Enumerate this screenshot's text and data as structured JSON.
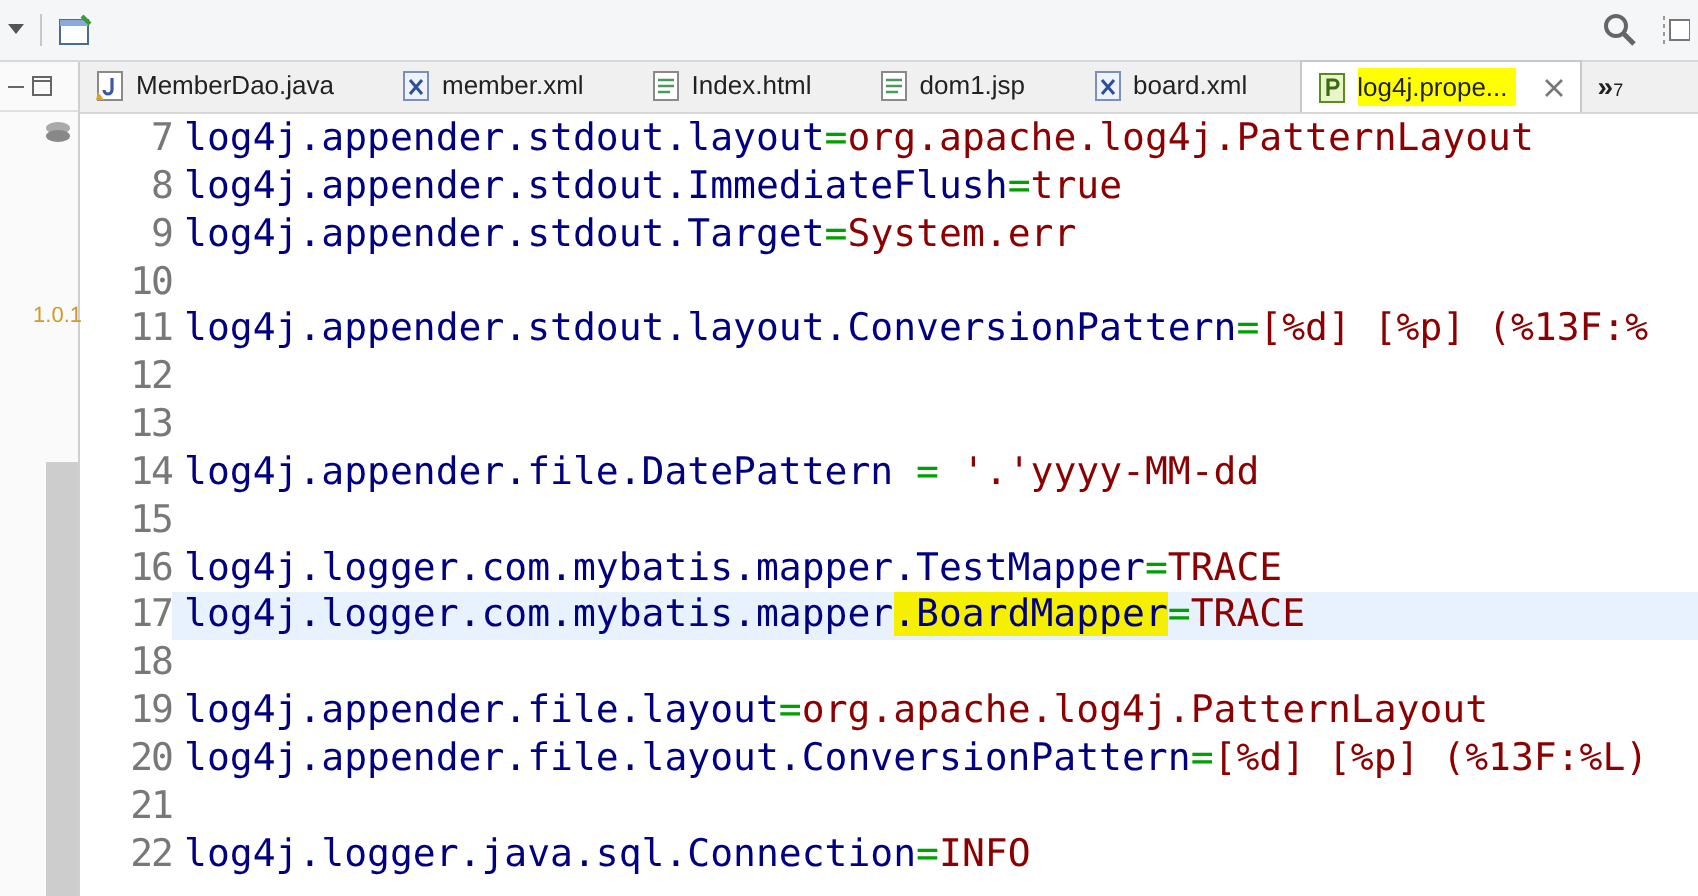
{
  "tabs": [
    {
      "label": "MemberDao.java",
      "kind": "java",
      "selected": false
    },
    {
      "label": "member.xml",
      "kind": "xml",
      "selected": false
    },
    {
      "label": "Index.html",
      "kind": "doc",
      "selected": false
    },
    {
      "label": "dom1.jsp",
      "kind": "doc",
      "selected": false
    },
    {
      "label": "board.xml",
      "kind": "xml",
      "selected": false
    },
    {
      "label": "log4j.prope...",
      "kind": "properties",
      "selected": true
    }
  ],
  "overflow": {
    "symbol": "»",
    "count": "7"
  },
  "side_panel": {
    "version": "1.0.1"
  },
  "lines": [
    {
      "number": "7",
      "key": "log4j.appender.stdout.layout",
      "sep": "=",
      "value": "org.apache.log4j.PatternLayout",
      "current": false
    },
    {
      "number": "8",
      "key": "log4j.appender.stdout.ImmediateFlush",
      "sep": "=",
      "value": "true",
      "current": false
    },
    {
      "number": "9",
      "key": "log4j.appender.stdout.Target",
      "sep": "=",
      "value": "System.err",
      "current": false
    },
    {
      "number": "10",
      "current": false
    },
    {
      "number": "11",
      "key": "log4j.appender.stdout.layout.ConversionPattern",
      "sep": "=",
      "value": "[%d] [%p] (%13F:%",
      "current": false
    },
    {
      "number": "12",
      "current": false
    },
    {
      "number": "13",
      "current": false
    },
    {
      "number": "14",
      "key": "log4j.appender.file.DatePattern ",
      "sep": "=",
      "value": " '.'yyyy-MM-dd",
      "current": false
    },
    {
      "number": "15",
      "current": false
    },
    {
      "number": "16",
      "key": "log4j.logger.com.mybatis.mapper.TestMapper",
      "sep": "=",
      "value": "TRACE",
      "current": false
    },
    {
      "number": "17",
      "key": "log4j.logger.com.mybatis.mapper",
      "highlighted": ".BoardMapper",
      "sep": "=",
      "value": "TRACE",
      "current": true
    },
    {
      "number": "18",
      "current": false
    },
    {
      "number": "19",
      "key": "log4j.appender.file.layout",
      "sep": "=",
      "value": "org.apache.log4j.PatternLayout",
      "current": false
    },
    {
      "number": "20",
      "key": "log4j.appender.file.layout.ConversionPattern",
      "sep": "=",
      "value": "[%d] [%p] (%13F:%L)",
      "current": false
    },
    {
      "number": "21",
      "current": false
    },
    {
      "number": "22",
      "key": "log4j.logger.java.sql.Connection",
      "sep": "=",
      "value": "INFO",
      "current": false
    }
  ]
}
